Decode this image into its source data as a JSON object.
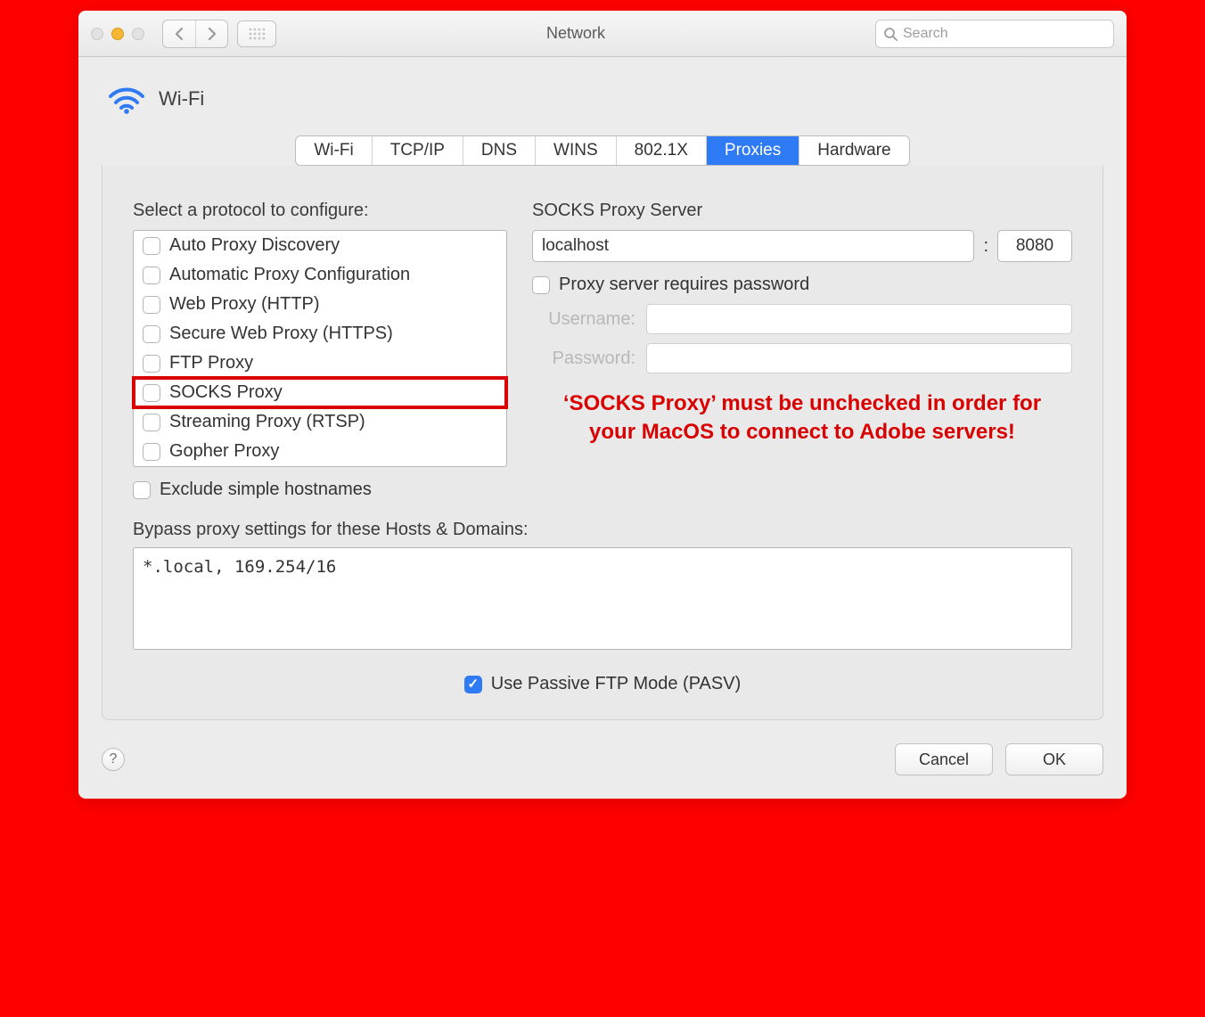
{
  "titlebar": {
    "title": "Network",
    "search_placeholder": "Search"
  },
  "header": {
    "wifi_label": "Wi-Fi"
  },
  "tabs": [
    "Wi-Fi",
    "TCP/IP",
    "DNS",
    "WINS",
    "802.1X",
    "Proxies",
    "Hardware"
  ],
  "active_tab_index": 5,
  "protocols": {
    "label": "Select a protocol to configure:",
    "items": [
      {
        "label": "Auto Proxy Discovery",
        "checked": false,
        "highlight": false
      },
      {
        "label": "Automatic Proxy Configuration",
        "checked": false,
        "highlight": false
      },
      {
        "label": "Web Proxy (HTTP)",
        "checked": false,
        "highlight": false
      },
      {
        "label": "Secure Web Proxy (HTTPS)",
        "checked": false,
        "highlight": false
      },
      {
        "label": "FTP Proxy",
        "checked": false,
        "highlight": false
      },
      {
        "label": "SOCKS Proxy",
        "checked": false,
        "highlight": true
      },
      {
        "label": "Streaming Proxy (RTSP)",
        "checked": false,
        "highlight": false
      },
      {
        "label": "Gopher Proxy",
        "checked": false,
        "highlight": false
      }
    ]
  },
  "exclude_simple": {
    "label": "Exclude simple hostnames",
    "checked": false
  },
  "server": {
    "label": "SOCKS Proxy Server",
    "host": "localhost",
    "port": "8080",
    "requires_password_label": "Proxy server requires password",
    "requires_password_checked": false,
    "username_label": "Username:",
    "password_label": "Password:",
    "username": "",
    "password": ""
  },
  "annotation": "‘SOCKS Proxy’ must be unchecked in order for your MacOS to connect to Adobe servers!",
  "bypass": {
    "label": "Bypass proxy settings for these Hosts & Domains:",
    "value": "*.local, 169.254/16"
  },
  "pasv": {
    "label": "Use Passive FTP Mode (PASV)",
    "checked": true
  },
  "footer": {
    "cancel": "Cancel",
    "ok": "OK"
  }
}
